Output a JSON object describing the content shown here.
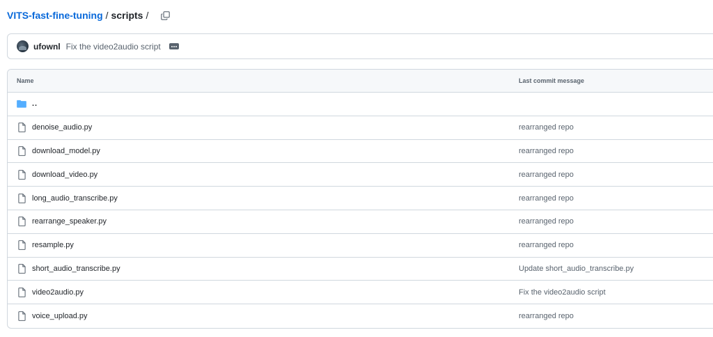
{
  "breadcrumb": {
    "repo": "VITS-fast-fine-tuning",
    "sep1": "/",
    "dir": "scripts",
    "sep2": "/"
  },
  "latest_commit": {
    "author": "ufownl",
    "message": "Fix the video2audio script"
  },
  "table": {
    "headers": {
      "name": "Name",
      "message": "Last commit message"
    },
    "parent_label": "..",
    "rows": [
      {
        "name": "denoise_audio.py",
        "message": "rearranged repo"
      },
      {
        "name": "download_model.py",
        "message": "rearranged repo"
      },
      {
        "name": "download_video.py",
        "message": "rearranged repo"
      },
      {
        "name": "long_audio_transcribe.py",
        "message": "rearranged repo"
      },
      {
        "name": "rearrange_speaker.py",
        "message": "rearranged repo"
      },
      {
        "name": "resample.py",
        "message": "rearranged repo"
      },
      {
        "name": "short_audio_transcribe.py",
        "message": "Update short_audio_transcribe.py"
      },
      {
        "name": "video2audio.py",
        "message": "Fix the video2audio script"
      },
      {
        "name": "voice_upload.py",
        "message": "rearranged repo"
      }
    ]
  },
  "colors": {
    "link": "#0969da",
    "folder": "#54aeff",
    "muted": "#59636e",
    "border": "#d0d7de"
  },
  "icons": {
    "copy": "copy-icon",
    "folder": "folder-icon",
    "file": "file-icon",
    "ellipsis": "ellipsis-icon"
  }
}
